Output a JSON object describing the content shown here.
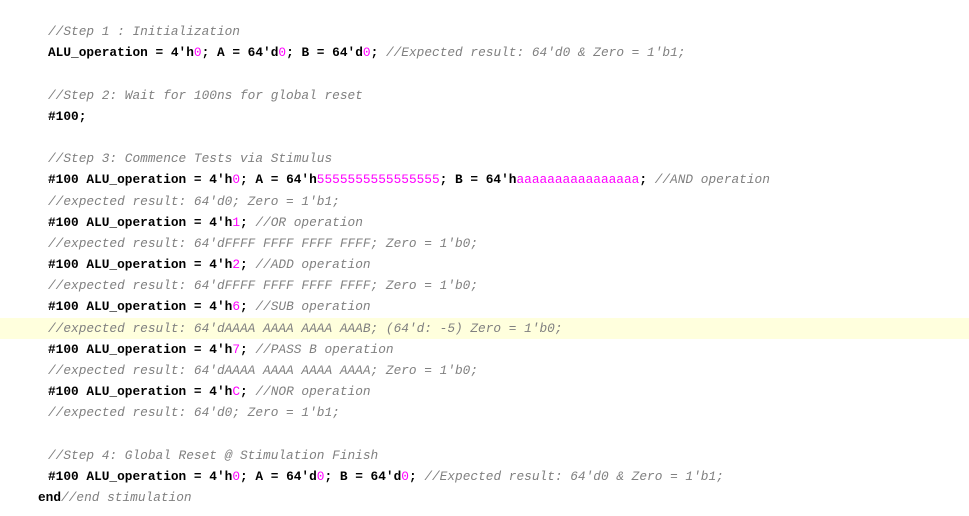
{
  "editor": {
    "highlight_color": "#ffffdd",
    "number_color": "#ff00ff",
    "comment_color": "#808080",
    "lines": [
      {
        "kind": "code",
        "segments": [
          {
            "t": "c",
            "v": "//Step 1 : Initialization"
          }
        ]
      },
      {
        "kind": "code",
        "segments": [
          {
            "t": "k",
            "v": "ALU_operation = 4'h"
          },
          {
            "t": "n",
            "v": "0"
          },
          {
            "t": "k",
            "v": "; A = 64'd"
          },
          {
            "t": "n",
            "v": "0"
          },
          {
            "t": "k",
            "v": "; B = 64'd"
          },
          {
            "t": "n",
            "v": "0"
          },
          {
            "t": "k",
            "v": "; "
          },
          {
            "t": "c",
            "v": "//Expected result: 64'd0 & Zero = 1'b1;"
          }
        ]
      },
      {
        "kind": "blank"
      },
      {
        "kind": "code",
        "segments": [
          {
            "t": "c",
            "v": "//Step 2: Wait for 100ns for global reset"
          }
        ]
      },
      {
        "kind": "code",
        "segments": [
          {
            "t": "k",
            "v": "#100;"
          }
        ]
      },
      {
        "kind": "blank"
      },
      {
        "kind": "code",
        "segments": [
          {
            "t": "c",
            "v": "//Step 3: Commence Tests via Stimulus"
          }
        ]
      },
      {
        "kind": "code",
        "segments": [
          {
            "t": "k",
            "v": "#100 ALU_operation = 4'h"
          },
          {
            "t": "n",
            "v": "0"
          },
          {
            "t": "k",
            "v": "; A = 64'h"
          },
          {
            "t": "n",
            "v": "5555555555555555"
          },
          {
            "t": "k",
            "v": "; B = 64'h"
          },
          {
            "t": "n",
            "v": "aaaaaaaaaaaaaaaa"
          },
          {
            "t": "k",
            "v": "; "
          },
          {
            "t": "c",
            "v": "//AND operation"
          }
        ]
      },
      {
        "kind": "code",
        "segments": [
          {
            "t": "c",
            "v": "//expected result: 64'd0; Zero = 1'b1;"
          }
        ]
      },
      {
        "kind": "code",
        "segments": [
          {
            "t": "k",
            "v": "#100 ALU_operation = 4'h"
          },
          {
            "t": "n",
            "v": "1"
          },
          {
            "t": "k",
            "v": "; "
          },
          {
            "t": "c",
            "v": "//OR operation"
          }
        ]
      },
      {
        "kind": "code",
        "segments": [
          {
            "t": "c",
            "v": "//expected result: 64'dFFFF FFFF FFFF FFFF; Zero = 1'b0;"
          }
        ]
      },
      {
        "kind": "code",
        "segments": [
          {
            "t": "k",
            "v": "#100 ALU_operation = 4'h"
          },
          {
            "t": "n",
            "v": "2"
          },
          {
            "t": "k",
            "v": "; "
          },
          {
            "t": "c",
            "v": "//ADD operation"
          }
        ]
      },
      {
        "kind": "code",
        "segments": [
          {
            "t": "c",
            "v": "//expected result: 64'dFFFF FFFF FFFF FFFF; Zero = 1'b0;"
          }
        ]
      },
      {
        "kind": "code",
        "segments": [
          {
            "t": "k",
            "v": "#100 ALU_operation = 4'h"
          },
          {
            "t": "n",
            "v": "6"
          },
          {
            "t": "k",
            "v": "; "
          },
          {
            "t": "c",
            "v": "//SUB operation"
          }
        ]
      },
      {
        "kind": "code",
        "highlight": true,
        "segments": [
          {
            "t": "c",
            "v": "//expected result: 64'dAAAA AAAA AAAA AAAB; (64'd: -5) Zero = 1'b0;"
          }
        ]
      },
      {
        "kind": "code",
        "segments": [
          {
            "t": "k",
            "v": "#100 ALU_operation = 4'h"
          },
          {
            "t": "n",
            "v": "7"
          },
          {
            "t": "k",
            "v": "; "
          },
          {
            "t": "c",
            "v": "//PASS B operation"
          }
        ]
      },
      {
        "kind": "code",
        "segments": [
          {
            "t": "c",
            "v": "//expected result: 64'dAAAA AAAA AAAA AAAA; Zero = 1'b0;"
          }
        ]
      },
      {
        "kind": "code",
        "segments": [
          {
            "t": "k",
            "v": "#100 ALU_operation = 4'h"
          },
          {
            "t": "n",
            "v": "C"
          },
          {
            "t": "k",
            "v": "; "
          },
          {
            "t": "c",
            "v": "//NOR operation"
          }
        ]
      },
      {
        "kind": "code",
        "segments": [
          {
            "t": "c",
            "v": "//expected result: 64'd0; Zero = 1'b1;"
          }
        ]
      },
      {
        "kind": "blank"
      },
      {
        "kind": "code",
        "segments": [
          {
            "t": "c",
            "v": "//Step 4: Global Reset @ Stimulation Finish"
          }
        ]
      },
      {
        "kind": "code",
        "segments": [
          {
            "t": "k",
            "v": "#100 ALU_operation = 4'h"
          },
          {
            "t": "n",
            "v": "0"
          },
          {
            "t": "k",
            "v": "; A = 64'd"
          },
          {
            "t": "n",
            "v": "0"
          },
          {
            "t": "k",
            "v": "; B = 64'd"
          },
          {
            "t": "n",
            "v": "0"
          },
          {
            "t": "k",
            "v": "; "
          },
          {
            "t": "c",
            "v": "//Expected result: 64'd0 & Zero = 1'b1;"
          }
        ]
      },
      {
        "kind": "code",
        "outdent": true,
        "segments": [
          {
            "t": "k",
            "v": "end"
          },
          {
            "t": "c",
            "v": "//end stimulation"
          }
        ]
      }
    ]
  }
}
